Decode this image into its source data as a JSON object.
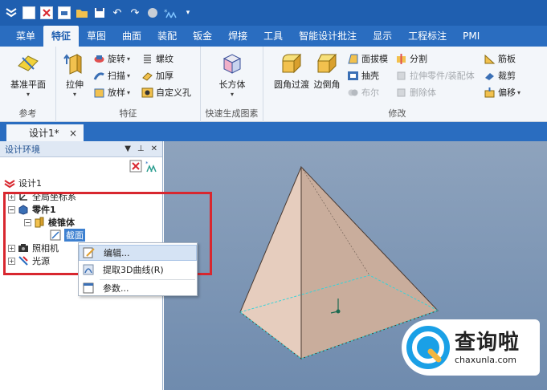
{
  "quick_access": {
    "icons": [
      "app-menu-icon",
      "new-icon",
      "close-doc-icon",
      "print-icon",
      "open-icon",
      "save-icon",
      "undo-icon",
      "redo-icon",
      "render-icon",
      "design-tree-icon",
      "dropdown-icon"
    ]
  },
  "ribbon_tabs": [
    {
      "label": "菜单",
      "active": false
    },
    {
      "label": "特征",
      "active": true
    },
    {
      "label": "草图",
      "active": false
    },
    {
      "label": "曲面",
      "active": false
    },
    {
      "label": "装配",
      "active": false
    },
    {
      "label": "钣金",
      "active": false
    },
    {
      "label": "焊接",
      "active": false
    },
    {
      "label": "工具",
      "active": false
    },
    {
      "label": "智能设计批注",
      "active": false
    },
    {
      "label": "显示",
      "active": false
    },
    {
      "label": "工程标注",
      "active": false
    },
    {
      "label": "PMI",
      "active": false
    }
  ],
  "ribbon": {
    "reference": {
      "group_label": "参考",
      "datum_plane": "基准平面"
    },
    "features": {
      "group_label": "特征",
      "extrude": "拉伸",
      "revolve": "旋转",
      "sweep": "扫描",
      "loft": "放样",
      "thread": "螺纹",
      "thicken": "加厚",
      "custom_hole": "自定义孔"
    },
    "quick_shapes": {
      "group_label": "快速生成图素",
      "box": "长方体"
    },
    "modify": {
      "group_label": "修改",
      "fillet": "圆角过渡",
      "chamfer": "边倒角",
      "draft": "面拔模",
      "shell": "抽壳",
      "boolean": "布尔",
      "split": "分割",
      "extrude_part": "拉伸零件/装配体",
      "delete_body": "删除体",
      "rib": "筋板",
      "trim": "裁剪",
      "offset": "偏移"
    }
  },
  "document": {
    "tab_title": "设计1*",
    "close": "×"
  },
  "panel": {
    "title": "设计环境",
    "tree": {
      "root": "设计1",
      "global_coord": "全局坐标系",
      "part": "零件1",
      "feature": "棱锥体",
      "section": "截面",
      "camera": "照相机",
      "light": "光源"
    }
  },
  "context_menu": {
    "edit": "编辑...",
    "extract_curve": "提取3D曲线(R)",
    "params": "参数..."
  },
  "watermark": {
    "cn": "查询啦",
    "en": "chaxunla.com"
  },
  "colors": {
    "title_bar": "#1f5fb0",
    "tab_bar": "#2a6dc0",
    "ribbon_bg": "#f3f6fa",
    "highlight_red": "#d8272f",
    "viewport_top": "#8ea3bd",
    "viewport_bottom": "#6f8bae",
    "pyramid_face_light": "#e6cdbe",
    "pyramid_face_dark": "#c9ad9c",
    "selection_cyan": "#35d3d9"
  }
}
